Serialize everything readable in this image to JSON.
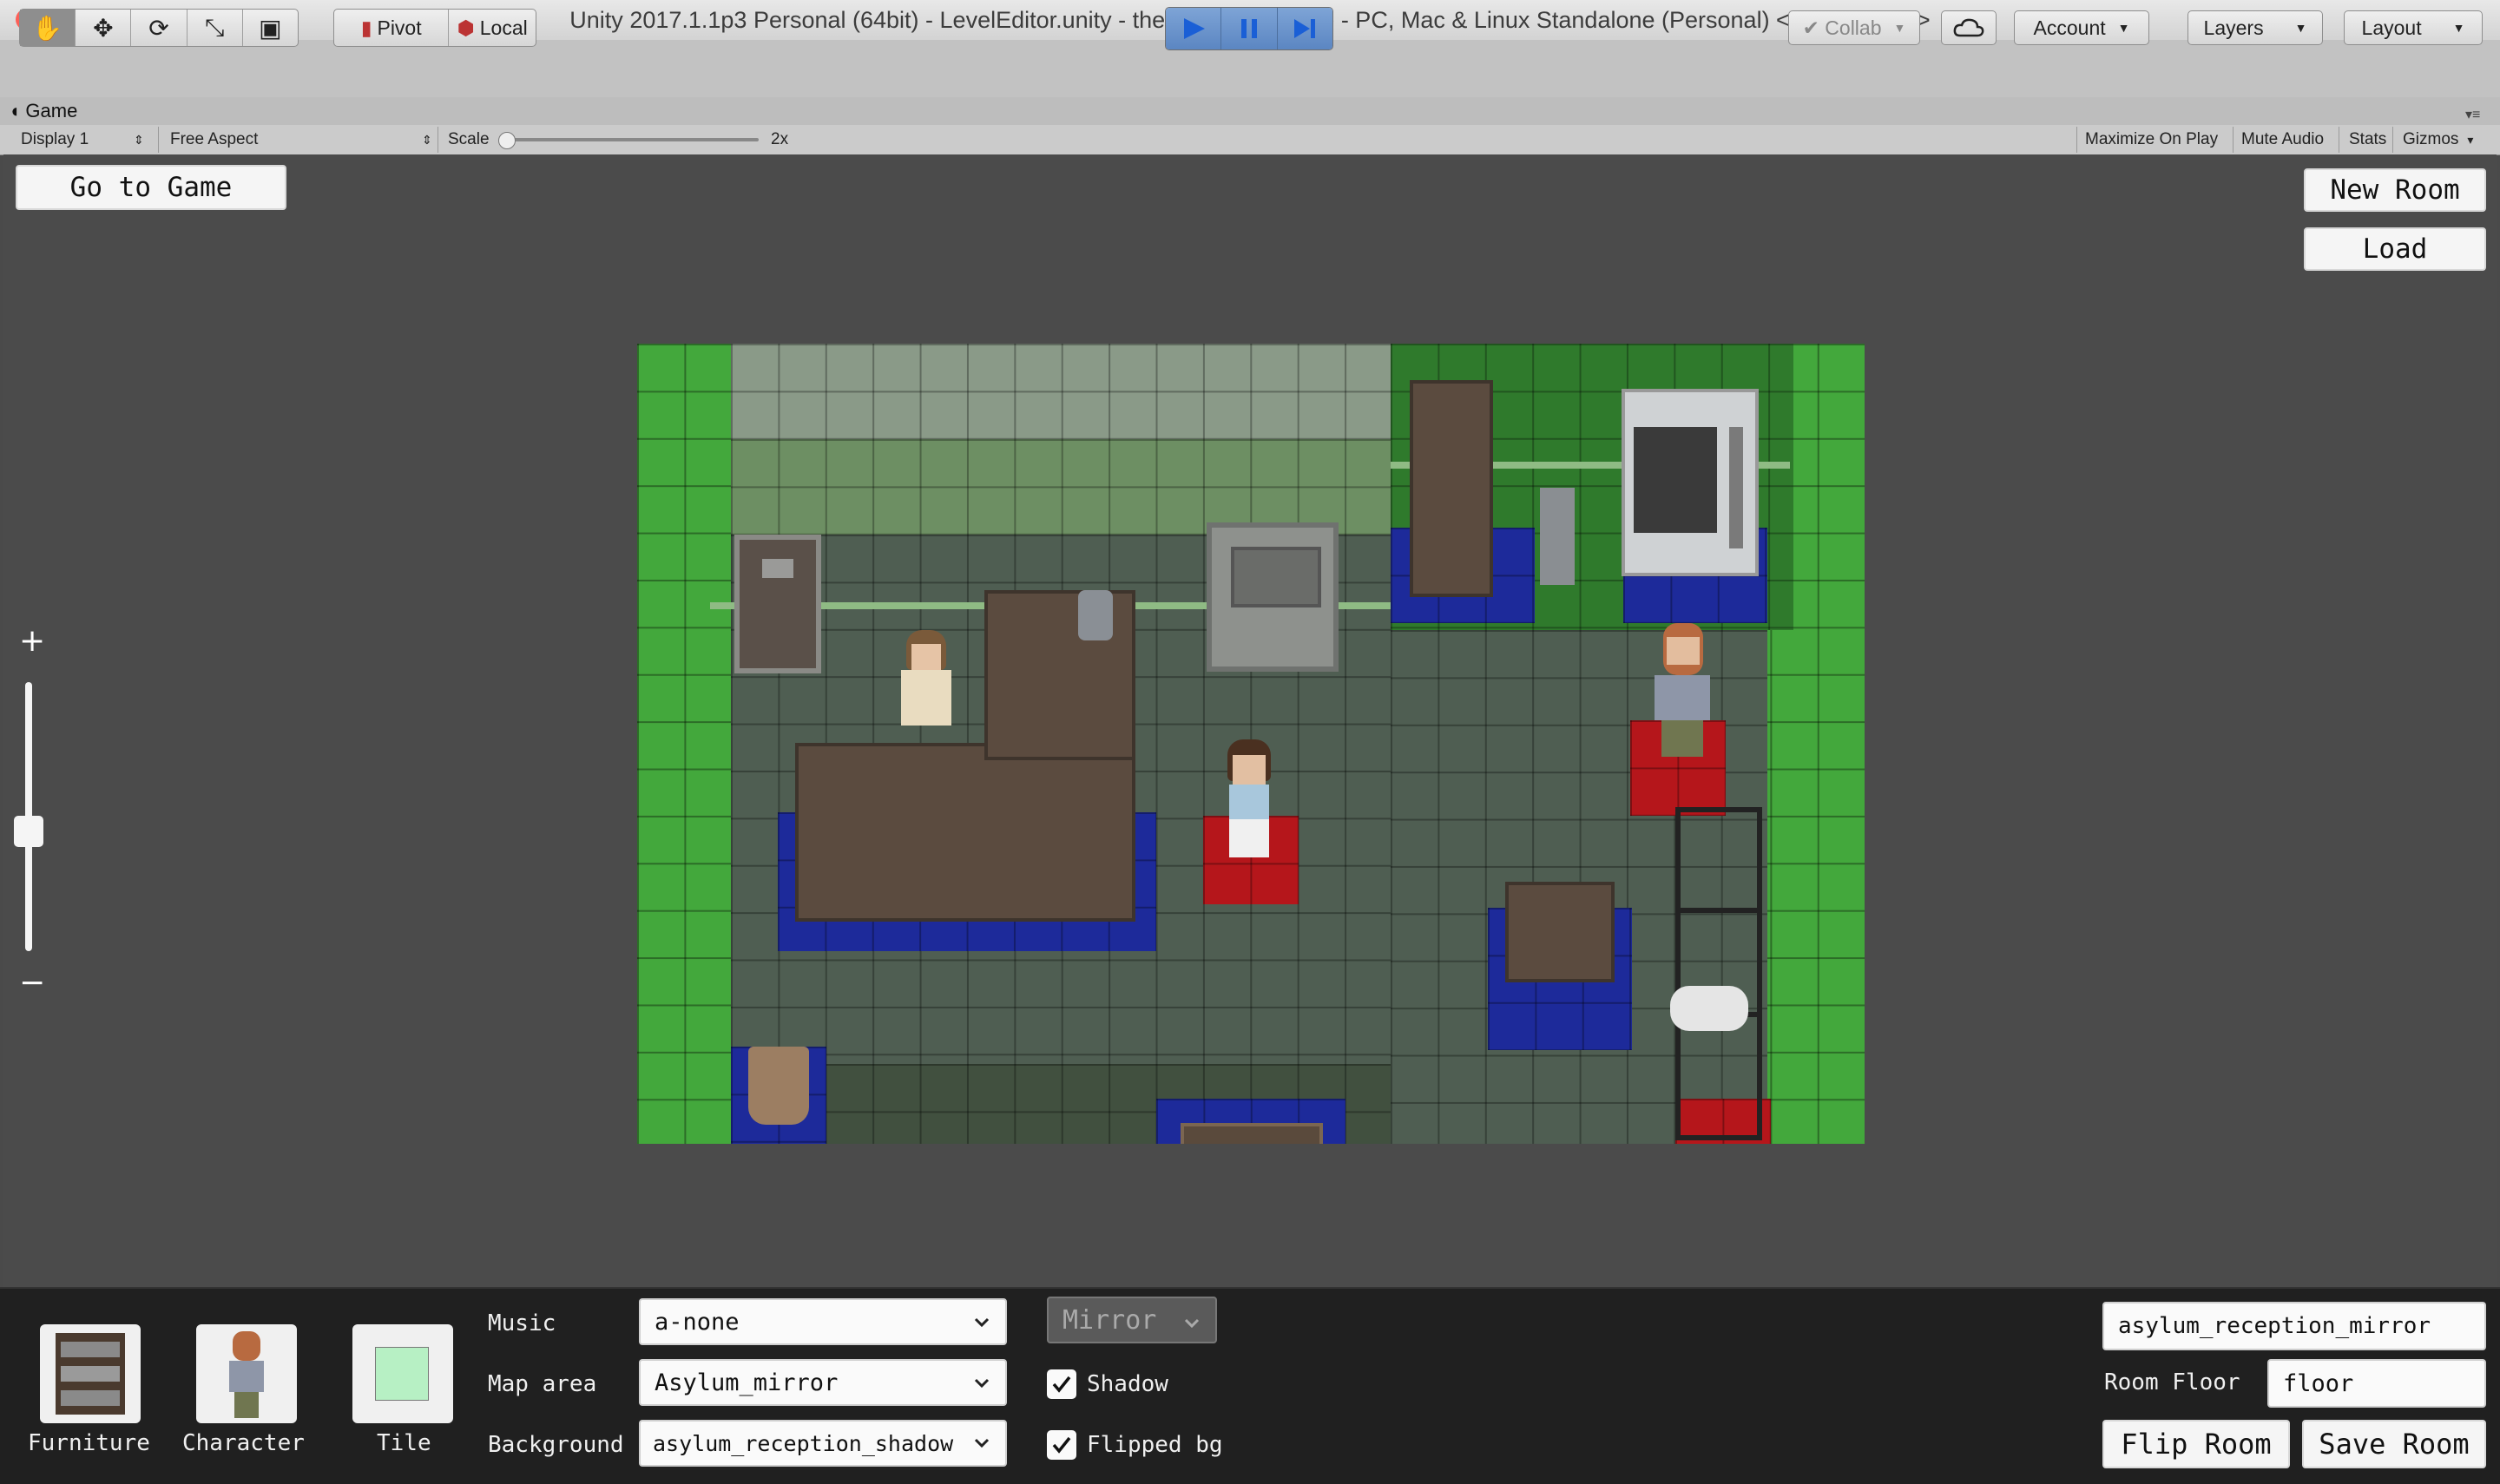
{
  "window": {
    "title": "Unity 2017.1.1p3 Personal (64bit) - LevelEditor.unity - the Splitting Engine - PC, Mac & Linux Standalone (Personal) <OpenGL 4.1>"
  },
  "toolbar": {
    "pivot_label": "Pivot",
    "local_label": "Local",
    "collab_label": "Collab",
    "account_label": "Account",
    "layers_label": "Layers",
    "layout_label": "Layout"
  },
  "game_tab": {
    "tab_label": "Game",
    "display_label": "Display 1",
    "aspect_label": "Free Aspect",
    "scale_label": "Scale",
    "scale_value": "2x",
    "maximize_label": "Maximize On Play",
    "mute_label": "Mute Audio",
    "stats_label": "Stats",
    "gizmos_label": "Gizmos"
  },
  "editor": {
    "go_to_game": "Go to Game",
    "new_room": "New Room",
    "load": "Load",
    "zoom_plus": "+",
    "zoom_minus": "−"
  },
  "palette": {
    "furniture": "Furniture",
    "character": "Character",
    "tile": "Tile",
    "tile_color": "#b7f0c4"
  },
  "settings": {
    "music_label": "Music",
    "music_value": "a-none",
    "map_area_label": "Map area",
    "map_area_value": "Asylum_mirror",
    "background_label": "Background",
    "background_value": "asylum_reception_shadow",
    "mirror_label": "Mirror",
    "shadow_label": "Shadow",
    "shadow_checked": true,
    "flipped_bg_label": "Flipped bg",
    "flipped_bg_checked": true
  },
  "room": {
    "name_value": "asylum_reception_mirror",
    "floor_label": "Room Floor",
    "floor_value": "floor",
    "flip_room": "Flip Room",
    "save_room": "Save Room"
  },
  "colors": {
    "grass": "#43a83c",
    "floor": "#4a5a4e",
    "wall": "#6a8a62",
    "blue_tile": "#1d2a9a",
    "red_tile": "#b5161b",
    "play_active": "#6f97cf"
  }
}
